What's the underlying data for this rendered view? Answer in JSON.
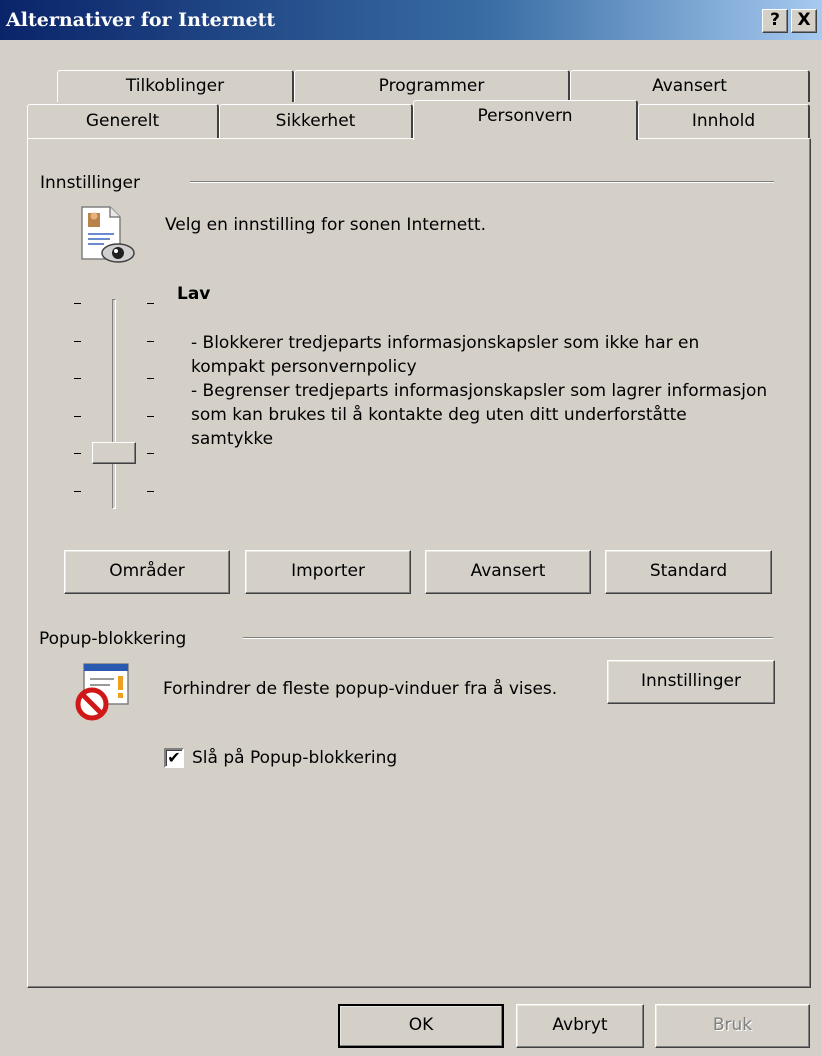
{
  "window": {
    "title": "Alternativer for Internett",
    "help_button": "?",
    "close_button": "X"
  },
  "tabs": {
    "back_row": [
      "Tilkoblinger",
      "Programmer",
      "Avansert"
    ],
    "front_row": [
      "Generelt",
      "Sikkerhet",
      "Personvern",
      "Innhold"
    ],
    "active": "Personvern"
  },
  "settings": {
    "group_label": "Innstillinger",
    "intro": "Velg en innstilling for sonen Internett.",
    "level_name": "Lav",
    "level_index": 1,
    "level_count": 6,
    "description": [
      "- Blokkerer tredjeparts informasjonskapsler som ikke har en kompakt personvernpolicy",
      "- Begrenser tredjeparts informasjonskapsler som lagrer informasjon som kan brukes til å kontakte deg uten ditt underforståtte samtykke"
    ],
    "buttons": [
      "Områder",
      "Importer",
      "Avansert",
      "Standard"
    ]
  },
  "popup": {
    "group_label": "Popup-blokkering",
    "text": "Forhindrer de fleste popup-vinduer fra å vises.",
    "settings_button": "Innstillinger",
    "checkbox_label": "Slå på Popup-blokkering",
    "checkbox_checked": true,
    "checkmark": "✔"
  },
  "footer": {
    "ok": "OK",
    "cancel": "Avbryt",
    "apply": "Bruk"
  },
  "colors": {
    "titlebar_start": "#0a246a",
    "titlebar_end": "#a6caf0",
    "face": "#d4d0c8"
  }
}
